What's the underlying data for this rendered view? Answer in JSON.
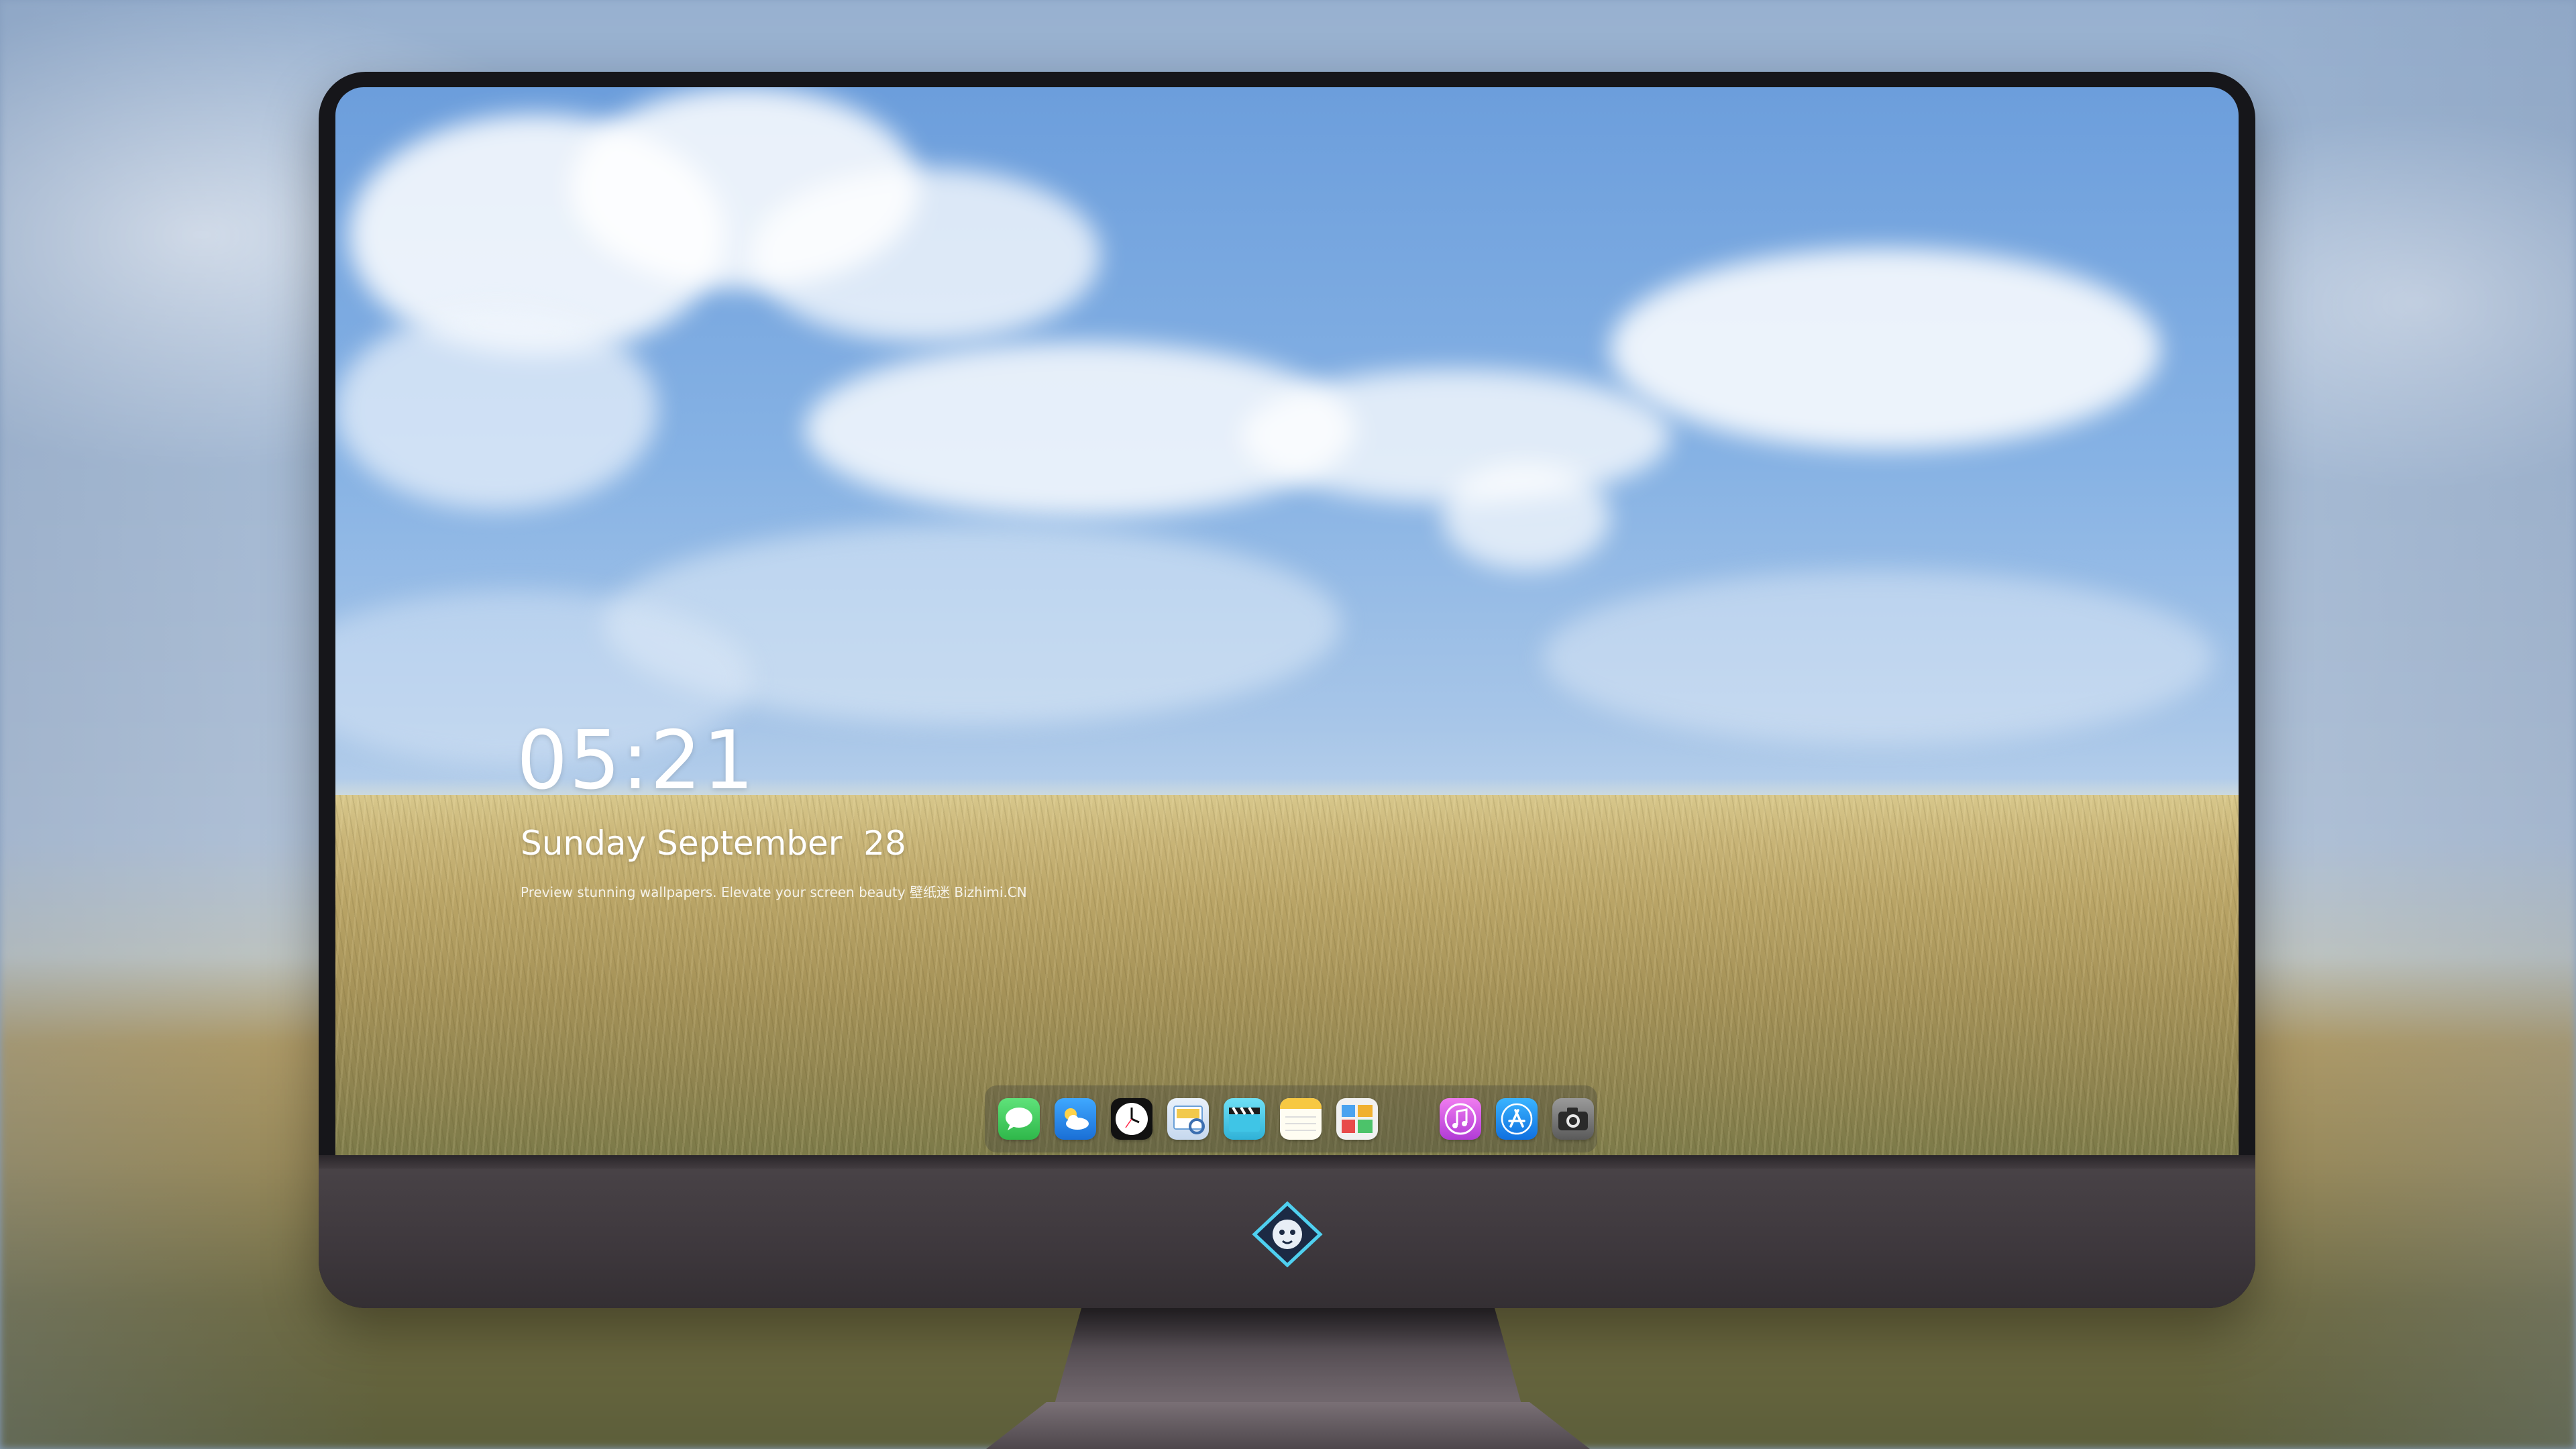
{
  "lockscreen": {
    "time": "05:21",
    "date": "Sunday September  28",
    "caption": "Preview stunning wallpapers. Elevate your screen beauty  壁纸迷  Bizhimi.CN"
  },
  "dock": {
    "items": [
      {
        "name": "messages-icon",
        "color": "#34c759"
      },
      {
        "name": "weather-icon",
        "color": "#1e8ef0"
      },
      {
        "name": "clock-icon",
        "color": "#111111"
      },
      {
        "name": "preview-icon",
        "color": "#f2c94c"
      },
      {
        "name": "clips-icon",
        "color": "#4cc9e8"
      },
      {
        "name": "notes-icon",
        "color": "#f7d04a"
      },
      {
        "name": "photos-gallery-icon",
        "color": "#e8e8e8"
      },
      {
        "name": "music-icon",
        "color": "#ce4fe0"
      },
      {
        "name": "app-store-icon",
        "color": "#1b8cf0"
      },
      {
        "name": "camera-icon",
        "color": "#777777"
      }
    ]
  },
  "monitor": {
    "logo": "mascot-logo-icon"
  }
}
